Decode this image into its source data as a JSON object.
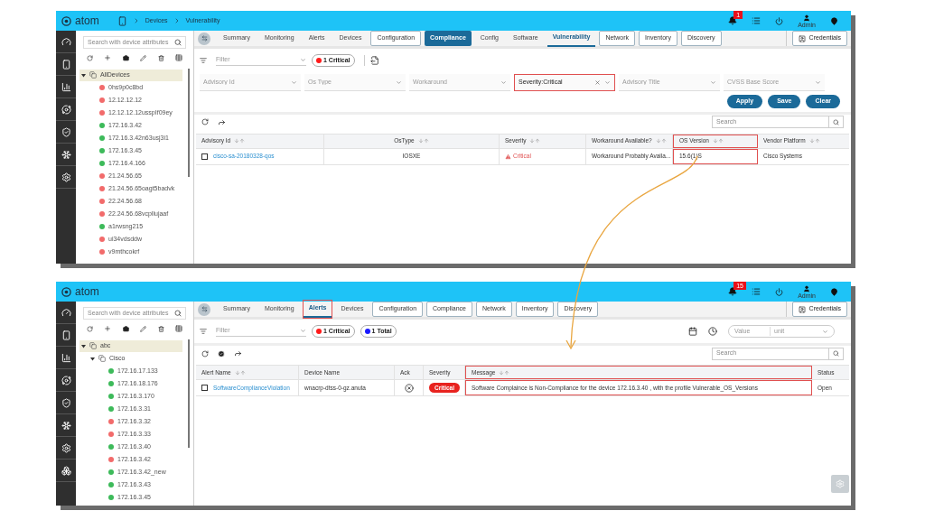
{
  "panels": [
    {
      "kind": "vulnerability",
      "header": {
        "logo": "atom",
        "breadcrumb": [
          "Devices",
          "Vulnerability"
        ],
        "notifications": "1",
        "user": "Admin"
      },
      "tree": {
        "search_placeholder": "Search with device attributes",
        "nodes": [
          {
            "label": "AllDevices",
            "selected": true,
            "expanded": true,
            "children": [
              {
                "label": "0hs9p0c8bd",
                "color": "#f26b6b"
              },
              {
                "label": "12.12.12.12",
                "color": "#f26b6b"
              },
              {
                "label": "12.12.12.12usspIf09ey",
                "color": "#f26b6b"
              },
              {
                "label": "172.16.3.42",
                "color": "#3dba5a"
              },
              {
                "label": "172.16.3.42n63usj3i1",
                "color": "#3dba5a"
              },
              {
                "label": "172.16.3.45",
                "color": "#3dba5a"
              },
              {
                "label": "172.16.4.166",
                "color": "#3dba5a"
              },
              {
                "label": "21.24.56.65",
                "color": "#f26b6b"
              },
              {
                "label": "21.24.56.65oagt5badvk",
                "color": "#f26b6b"
              },
              {
                "label": "22.24.56.68",
                "color": "#f26b6b"
              },
              {
                "label": "22.24.56.68vcpllujaaf",
                "color": "#f26b6b"
              },
              {
                "label": "a1rwsng215",
                "color": "#3dba5a"
              },
              {
                "label": "ui34vdsddw",
                "color": "#f26b6b"
              },
              {
                "label": "v9mthcokrf",
                "color": "#f26b6b"
              }
            ]
          }
        ]
      },
      "tabs": [
        {
          "label": "Summary",
          "kind": "text",
          "selected": false,
          "highlighted": false
        },
        {
          "label": "Monitoring",
          "kind": "text",
          "selected": false,
          "highlighted": false
        },
        {
          "label": "Alerts",
          "kind": "text",
          "selected": false,
          "highlighted": false
        },
        {
          "label": "Devices",
          "kind": "text",
          "selected": false,
          "highlighted": false
        },
        {
          "label": "Configuration",
          "kind": "outlined",
          "selected": false,
          "highlighted": false
        },
        {
          "label": "Compliance",
          "kind": "filled",
          "selected": false,
          "highlighted": false
        },
        {
          "label": "Config",
          "kind": "text",
          "selected": false,
          "highlighted": false
        },
        {
          "label": "Software",
          "kind": "text",
          "selected": false,
          "highlighted": false
        },
        {
          "label": "Vulnerability",
          "kind": "text",
          "selected": true,
          "highlighted": false
        },
        {
          "label": "Network",
          "kind": "outlined",
          "selected": false,
          "highlighted": false
        },
        {
          "label": "Inventory",
          "kind": "outlined",
          "selected": false,
          "highlighted": false
        },
        {
          "label": "Discovery",
          "kind": "outlined",
          "selected": false,
          "highlighted": false
        }
      ],
      "credentials": "Credentials",
      "toolbar": {
        "filter_placeholder": "Filter",
        "chips": [
          {
            "label": "1 Critical",
            "color": "#ff1a1a"
          }
        ]
      },
      "filters": [
        {
          "placeholder": "Advisory Id",
          "highlighted": false
        },
        {
          "placeholder": "Os Type",
          "highlighted": false
        },
        {
          "placeholder": "Workaround",
          "highlighted": false
        },
        {
          "value": "Severity:Critical",
          "highlighted": true
        },
        {
          "placeholder": "Advisory Title",
          "highlighted": false
        },
        {
          "placeholder": "CVSS Base Score",
          "highlighted": false
        }
      ],
      "actions": [
        "Apply",
        "Save",
        "Clear"
      ],
      "table": {
        "search_placeholder": "Search",
        "columns": [
          {
            "label": "Advisory Id",
            "sortable": true,
            "highlighted": false
          },
          {
            "label": "OsType",
            "sortable": true,
            "highlighted": false
          },
          {
            "label": "Severity",
            "sortable": true,
            "highlighted": false
          },
          {
            "label": "Workaround Available?",
            "sortable": true,
            "highlighted": false
          },
          {
            "label": "OS Version",
            "sortable": true,
            "highlighted": true
          },
          {
            "label": "Vendor Platform",
            "sortable": true,
            "highlighted": false
          }
        ],
        "rows": [
          {
            "checked": false,
            "cells": [
              {
                "kind": "link",
                "text": "cisco-sa-20180328-qos"
              },
              {
                "kind": "center",
                "text": "IOSXE"
              },
              {
                "kind": "warning",
                "text": "Critical"
              },
              {
                "kind": "text",
                "text": "Workaround Probably Availa..."
              },
              {
                "kind": "text",
                "text": "15.6(1)S"
              },
              {
                "kind": "text",
                "text": "Cisco Systems"
              }
            ]
          }
        ]
      }
    },
    {
      "kind": "alerts",
      "header": {
        "logo": "atom",
        "notifications": "15",
        "user": "Admin"
      },
      "tree": {
        "search_placeholder": "Search with device attributes",
        "nodes": [
          {
            "label": "abc",
            "selected": true,
            "expanded": true,
            "children": [
              {
                "label": "Cisco",
                "selected": false,
                "expanded": true,
                "children": [
                  {
                    "label": "172.16.17.133",
                    "color": "#3dba5a"
                  },
                  {
                    "label": "172.16.18.176",
                    "color": "#3dba5a"
                  },
                  {
                    "label": "172.16.3.170",
                    "color": "#3dba5a"
                  },
                  {
                    "label": "172.16.3.31",
                    "color": "#3dba5a"
                  },
                  {
                    "label": "172.16.3.32",
                    "color": "#f26b6b"
                  },
                  {
                    "label": "172.16.3.33",
                    "color": "#f26b6b"
                  },
                  {
                    "label": "172.16.3.40",
                    "color": "#3dba5a"
                  },
                  {
                    "label": "172.16.3.42",
                    "color": "#f26b6b"
                  },
                  {
                    "label": "172.16.3.42_new",
                    "color": "#3dba5a"
                  },
                  {
                    "label": "172.16.3.43",
                    "color": "#3dba5a"
                  },
                  {
                    "label": "172.16.3.45",
                    "color": "#3dba5a"
                  }
                ]
              }
            ]
          }
        ]
      },
      "tabs": [
        {
          "label": "Summary",
          "kind": "text",
          "selected": false,
          "highlighted": false
        },
        {
          "label": "Monitoring",
          "kind": "text",
          "selected": false,
          "highlighted": false
        },
        {
          "label": "Alerts",
          "kind": "text",
          "selected": true,
          "highlighted": true
        },
        {
          "label": "Devices",
          "kind": "text",
          "selected": false,
          "highlighted": false
        },
        {
          "label": "Configuration",
          "kind": "outlined",
          "selected": false,
          "highlighted": false
        },
        {
          "label": "Compliance",
          "kind": "outlined",
          "selected": false,
          "highlighted": false
        },
        {
          "label": "Network",
          "kind": "outlined",
          "selected": false,
          "highlighted": false
        },
        {
          "label": "Inventory",
          "kind": "outlined",
          "selected": false,
          "highlighted": false
        },
        {
          "label": "Discovery",
          "kind": "outlined",
          "selected": false,
          "highlighted": false
        }
      ],
      "credentials": "Credentials",
      "toolbar": {
        "filter_placeholder": "Filter",
        "chips": [
          {
            "label": "1 Critical",
            "color": "#ff1a1a"
          },
          {
            "label": "1 Total",
            "color": "#1a1aff"
          }
        ],
        "value_placeholder": "Value",
        "unit_placeholder": "unit"
      },
      "table": {
        "search_placeholder": "Search",
        "columns": [
          {
            "label": "Alert Name",
            "sortable": true,
            "highlighted": false
          },
          {
            "label": "Device Name",
            "sortable": false,
            "highlighted": false
          },
          {
            "label": "Ack",
            "sortable": false,
            "highlighted": false
          },
          {
            "label": "Severity",
            "sortable": false,
            "highlighted": false
          },
          {
            "label": "Message",
            "sortable": true,
            "highlighted": true
          },
          {
            "label": "Status",
            "sortable": false,
            "highlighted": false
          }
        ],
        "rows": [
          {
            "checked": false,
            "cells": [
              {
                "kind": "link",
                "text": "SoftwareComplianceViolation"
              },
              {
                "kind": "text",
                "text": "wnacrp-dtss-0-gz.anuta"
              },
              {
                "kind": "ack"
              },
              {
                "kind": "badge",
                "text": "Critical"
              },
              {
                "kind": "text",
                "text": "Software Complaince is Non-Compliance for the device 172.16.3.40 , with the profile Vulnerable_OS_Versions"
              },
              {
                "kind": "text",
                "text": "Open"
              }
            ]
          }
        ]
      }
    }
  ]
}
